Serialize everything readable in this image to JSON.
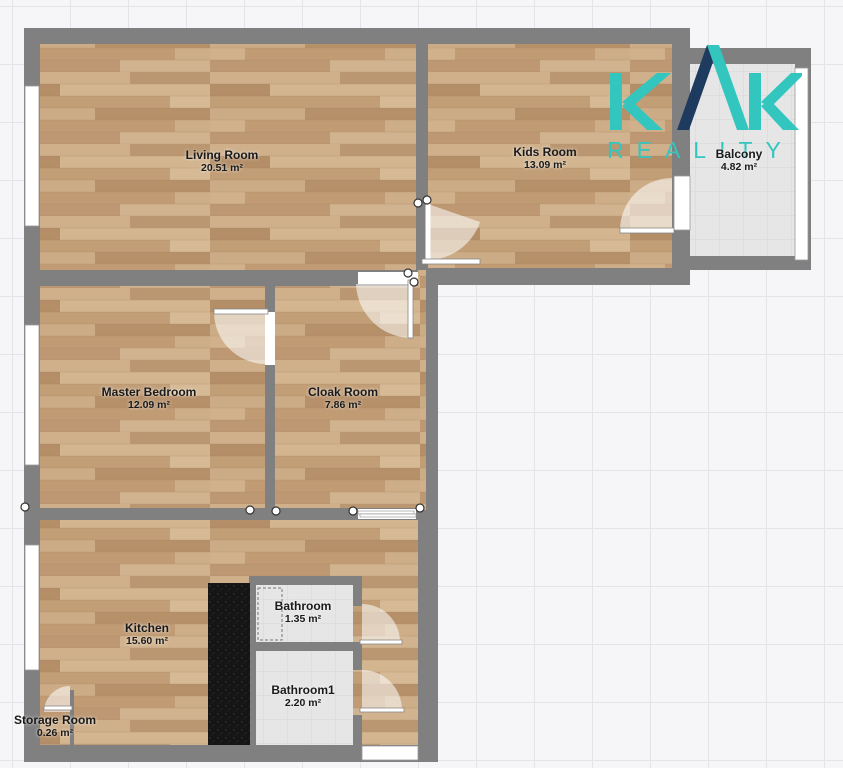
{
  "logo": {
    "mark": "KVK",
    "word": "REALITY",
    "teal": "#33c6bf",
    "navy": "#1f3a5f"
  },
  "colors": {
    "wall": "#808080",
    "floor_light": "#c9a983",
    "floor_dark": "#a9835c",
    "tile": "#e4e4e4",
    "counter": "#161616"
  },
  "rooms": [
    {
      "id": "living-room",
      "name": "Living Room",
      "area": "20.51 m²"
    },
    {
      "id": "kids-room",
      "name": "Kids Room",
      "area": "13.09 m²"
    },
    {
      "id": "balcony",
      "name": "Balcony",
      "area": "4.82 m²"
    },
    {
      "id": "master-bedroom",
      "name": "Master Bedroom",
      "area": "12.09 m²"
    },
    {
      "id": "cloak-room",
      "name": "Cloak Room",
      "area": "7.86 m²"
    },
    {
      "id": "kitchen",
      "name": "Kitchen",
      "area": "15.60 m²"
    },
    {
      "id": "bathroom",
      "name": "Bathroom",
      "area": "1.35 m²"
    },
    {
      "id": "bathroom1",
      "name": "Bathroom1",
      "area": "2.20 m²"
    },
    {
      "id": "storage-room",
      "name": "Storage Room",
      "area": "0.26 m²"
    }
  ]
}
